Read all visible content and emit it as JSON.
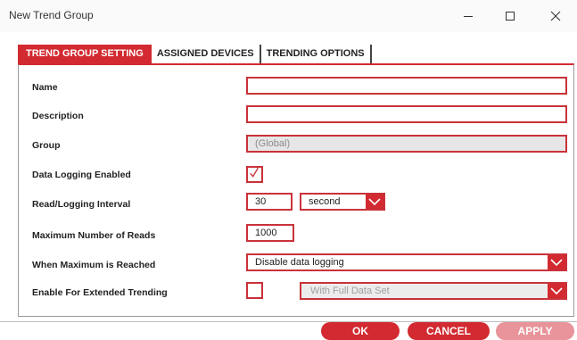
{
  "window": {
    "title": "New Trend Group"
  },
  "tabs": [
    {
      "label": "TREND GROUP SETTING",
      "active": true
    },
    {
      "label": "ASSIGNED DEVICES",
      "active": false
    },
    {
      "label": "TRENDING OPTIONS",
      "active": false
    }
  ],
  "form": {
    "name": {
      "label": "Name",
      "value": ""
    },
    "description": {
      "label": "Description",
      "value": ""
    },
    "group": {
      "label": "Group",
      "value": "(Global)"
    },
    "data_logging": {
      "label": "Data Logging Enabled",
      "checked": true
    },
    "interval": {
      "label": "Read/Logging Interval",
      "value": "30",
      "unit": "second"
    },
    "max_reads": {
      "label": "Maximum Number of Reads",
      "value": "1000"
    },
    "when_max": {
      "label": "When Maximum is Reached",
      "value": "Disable data logging"
    },
    "extended": {
      "label": "Enable For Extended Trending",
      "checked": false,
      "dropdown_value": "With Full Data Set"
    }
  },
  "buttons": {
    "ok": "OK",
    "cancel": "CANCEL",
    "apply": "APPLY"
  },
  "colors": {
    "accent": "#d22a30",
    "apply_disabled": "#e9949a",
    "field_border": "#c9323a"
  }
}
